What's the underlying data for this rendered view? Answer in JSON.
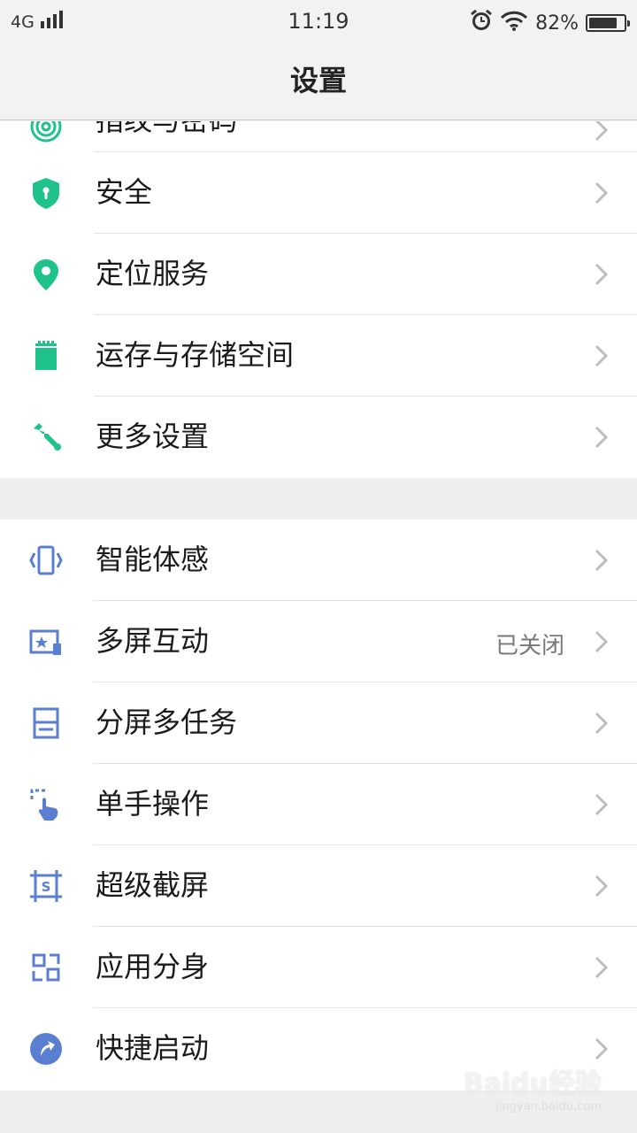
{
  "status_bar": {
    "network": "4G",
    "time": "11:19",
    "battery": "82%",
    "battery_level": 0.82
  },
  "header": {
    "title": "设置"
  },
  "group1": [
    {
      "label": "指纹与密码",
      "icon": "fingerprint-icon",
      "partial": true
    },
    {
      "label": "安全",
      "icon": "shield-icon"
    },
    {
      "label": "定位服务",
      "icon": "location-pin-icon"
    },
    {
      "label": "运存与存储空间",
      "icon": "sd-card-icon"
    },
    {
      "label": "更多设置",
      "icon": "wrench-icon"
    }
  ],
  "group2": [
    {
      "label": "智能体感",
      "icon": "motion-sense-icon"
    },
    {
      "label": "多屏互动",
      "icon": "screen-cast-icon",
      "status": "已关闭"
    },
    {
      "label": "分屏多任务",
      "icon": "split-screen-icon"
    },
    {
      "label": "单手操作",
      "icon": "one-hand-icon"
    },
    {
      "label": "超级截屏",
      "icon": "screenshot-icon"
    },
    {
      "label": "应用分身",
      "icon": "app-clone-icon"
    },
    {
      "label": "快捷启动",
      "icon": "quick-launch-icon"
    }
  ],
  "watermark": {
    "main": "Baidu经验",
    "sub": "jingyan.baidu.com"
  },
  "colors": {
    "green": "#1fc28a",
    "blue": "#5b7fd0",
    "chevron": "#bdbdbd"
  }
}
